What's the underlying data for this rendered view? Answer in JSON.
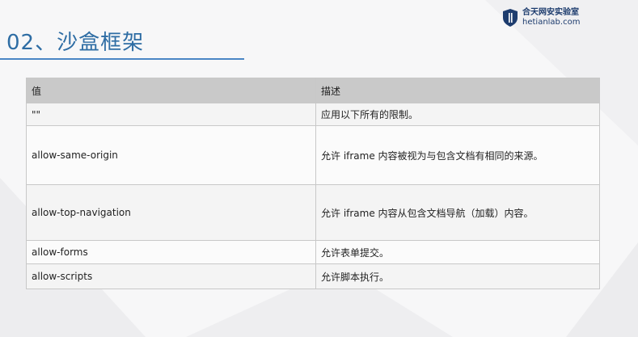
{
  "slide": {
    "title": "02、沙盒框架"
  },
  "logo": {
    "name_cn": "合天网安实验室",
    "name_en": "hetianlab.com"
  },
  "table": {
    "headers": [
      "值",
      "描述"
    ],
    "rows": [
      {
        "value": "\"\"",
        "desc": "应用以下所有的限制。"
      },
      {
        "value": "allow-same-origin",
        "desc": "允许 iframe 内容被视为与包含文档有相同的来源。"
      },
      {
        "value": "allow-top-navigation",
        "desc": "允许 iframe 内容从包含文档导航（加载）内容。"
      },
      {
        "value": "allow-forms",
        "desc": "允许表单提交。"
      },
      {
        "value": "allow-scripts",
        "desc": "允许脚本执行。"
      }
    ]
  },
  "colors": {
    "title": "#2e6da4",
    "header_bg": "#c9c9c9",
    "logo": "#1d3c6e"
  }
}
